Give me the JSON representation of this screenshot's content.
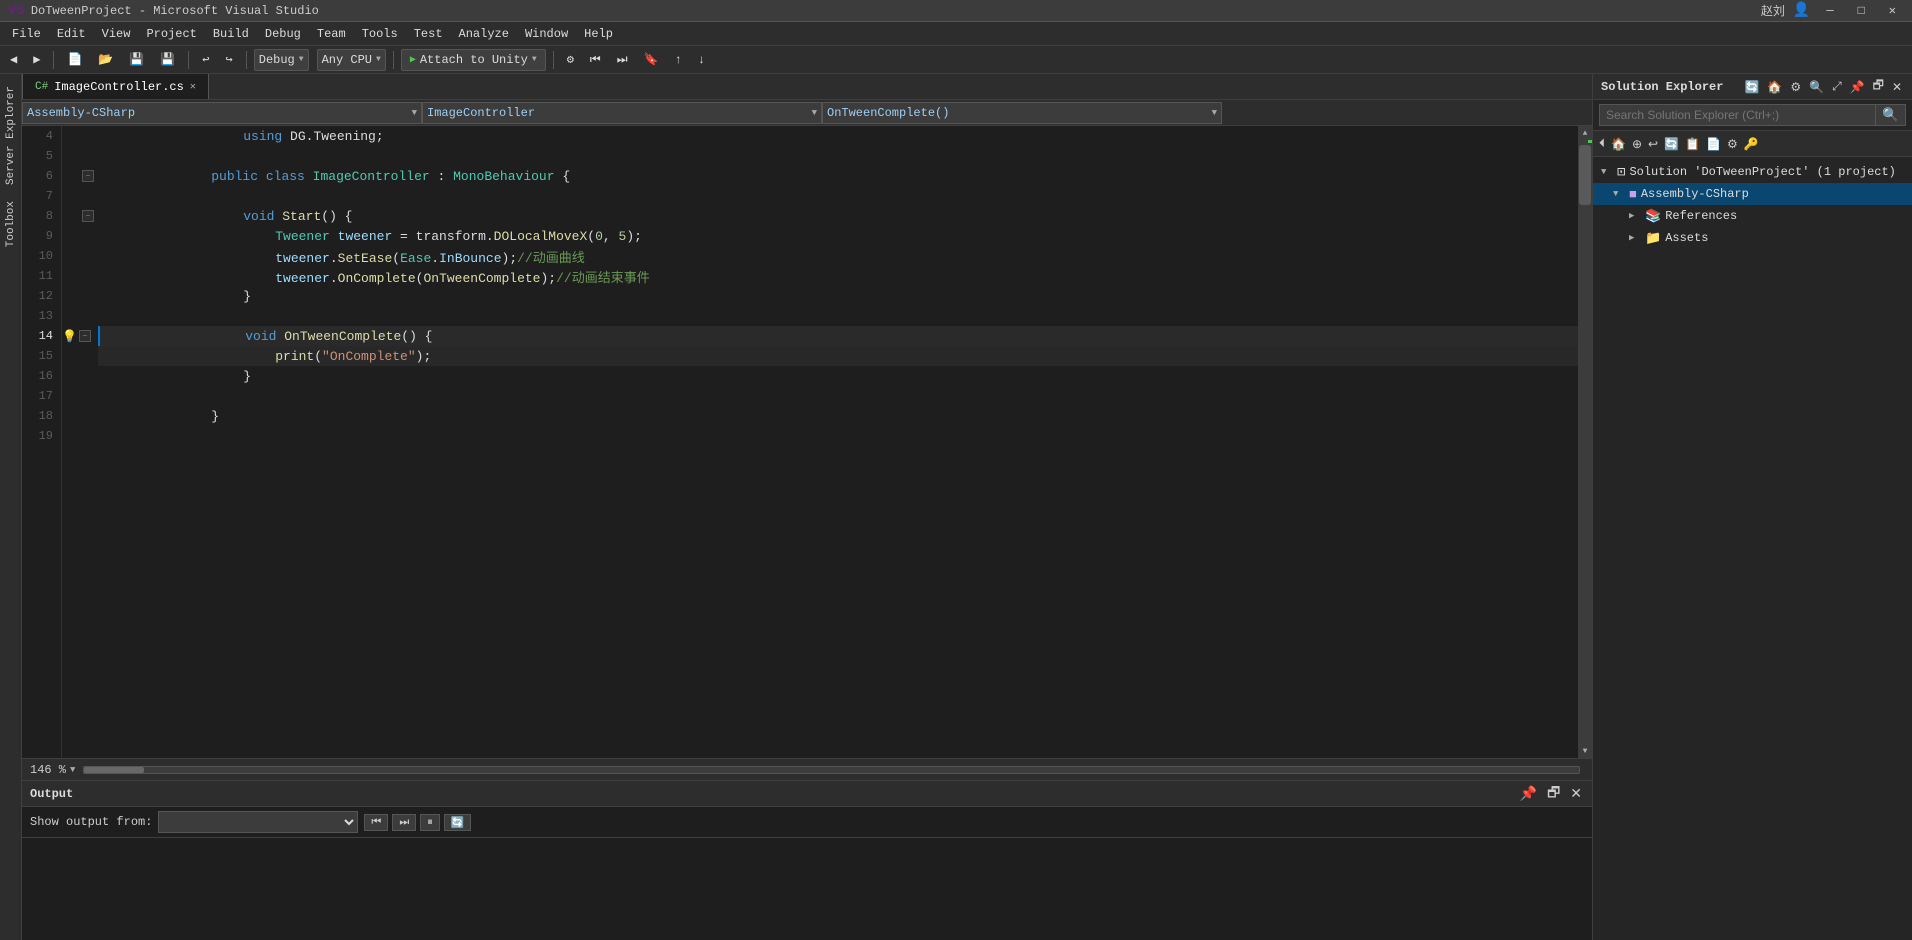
{
  "titlebar": {
    "title": "DoTweenProject - Microsoft Visual Studio",
    "vs_icon": "VS"
  },
  "menubar": {
    "items": [
      "File",
      "Edit",
      "View",
      "Project",
      "Build",
      "Debug",
      "Team",
      "Tools",
      "Test",
      "Analyze",
      "Window",
      "Help"
    ]
  },
  "toolbar": {
    "debug_label": "Debug",
    "cpu_label": "Any CPU",
    "attach_label": "Attach to Unity",
    "user_label": "赵刘",
    "sign_in_icon": "👤"
  },
  "tabs": {
    "active_tab": "ImageController.cs",
    "items": [
      {
        "label": "ImageController.cs",
        "active": true
      }
    ]
  },
  "nav_bar": {
    "namespace": "Assembly-CSharp",
    "class": "ImageController",
    "method": "OnTweenComplete()"
  },
  "code": {
    "lines": [
      {
        "num": 4,
        "content": "    using DG.Tweening;",
        "indent": 1
      },
      {
        "num": 5,
        "content": "",
        "indent": 0
      },
      {
        "num": 6,
        "content": "public class ImageController : MonoBehaviour {",
        "indent": 0,
        "collapsible": true
      },
      {
        "num": 7,
        "content": "",
        "indent": 0
      },
      {
        "num": 8,
        "content": "    void Start() {",
        "indent": 1,
        "collapsible": true
      },
      {
        "num": 9,
        "content": "        Tweener tweener = transform.DOLocalMoveX(0, 5);",
        "indent": 2
      },
      {
        "num": 10,
        "content": "        tweener.SetEase(Ease.InBounce);//动画曲线",
        "indent": 2
      },
      {
        "num": 11,
        "content": "        tweener.OnComplete(OnTweenComplete);//动画结束事件",
        "indent": 2
      },
      {
        "num": 12,
        "content": "    }",
        "indent": 1
      },
      {
        "num": 13,
        "content": "",
        "indent": 0
      },
      {
        "num": 14,
        "content": "    void OnTweenComplete() {",
        "indent": 1,
        "collapsible": true,
        "lightbulb": true,
        "active": true
      },
      {
        "num": 15,
        "content": "        print(\"OnComplete\");",
        "indent": 2
      },
      {
        "num": 16,
        "content": "    }",
        "indent": 1
      },
      {
        "num": 17,
        "content": "",
        "indent": 0
      },
      {
        "num": 18,
        "content": "}",
        "indent": 0
      },
      {
        "num": 19,
        "content": "",
        "indent": 0
      }
    ]
  },
  "zoom": {
    "level": "146 %"
  },
  "output": {
    "title": "Output",
    "show_output_from_label": "Show output from:",
    "source": ""
  },
  "solution_explorer": {
    "title": "Solution Explorer",
    "search_placeholder": "Search Solution Explorer (Ctrl+;)",
    "tree": {
      "solution": "Solution 'DoTweenProject' (1 project)",
      "project": "Assembly-CSharp",
      "references": "References",
      "assets": "Assets"
    }
  },
  "sidebar": {
    "items": [
      "Server Explorer",
      "Toolbox"
    ]
  }
}
